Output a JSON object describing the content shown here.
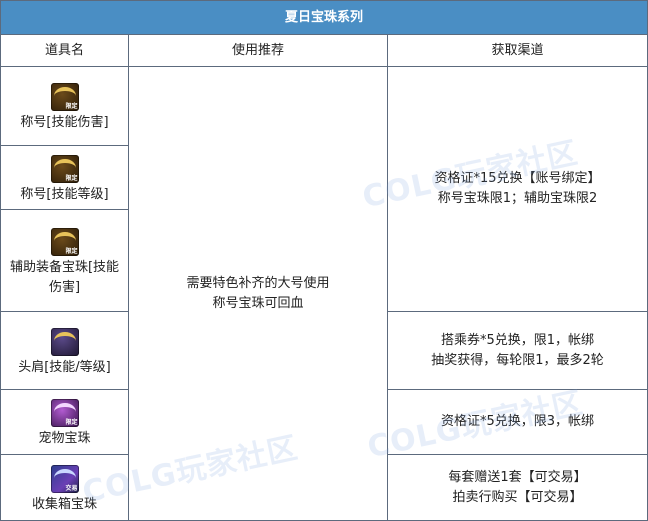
{
  "table": {
    "title": "夏日宝珠系列",
    "headers": [
      "道具名",
      "使用推荐",
      "获取渠道"
    ],
    "rows": [
      {
        "name": "称号[技能伤害]",
        "icon": "title-bead-limited-icon"
      },
      {
        "name": "称号[技能等级]",
        "icon": "title-bead-limited-icon"
      },
      {
        "name": "辅助装备宝珠[技能伤害]",
        "icon": "auxiliary-bead-limited-icon"
      },
      {
        "name": "头肩[技能/等级]",
        "icon": "shoulder-bead-icon"
      },
      {
        "name": "宠物宝珠",
        "icon": "pet-bead-limited-icon"
      },
      {
        "name": "收集箱宝珠",
        "icon": "collection-box-bead-trade-icon"
      }
    ],
    "recommendation": [
      "需要特色补齐的大号使用",
      "称号宝珠可回血"
    ],
    "channels": [
      {
        "lines": [
          "资格证*15兑换【账号绑定】",
          "称号宝珠限1；辅助宝珠限2"
        ]
      },
      {
        "lines": [
          "搭乘券*5兑换，限1，帐绑",
          "抽奖获得，每轮限1，最多2轮"
        ]
      },
      {
        "lines": [
          "资格证*5兑换，限3，帐绑"
        ]
      },
      {
        "lines": [
          "每套赠送1套【可交易】",
          "拍卖行购买【可交易】"
        ]
      }
    ],
    "icon_tags": {
      "limited": "限定",
      "trade": "交易"
    }
  },
  "watermark": "COLG玩家社区",
  "colors": {
    "header_bg": "#4a8ec4",
    "border": "#5c6a7d"
  }
}
